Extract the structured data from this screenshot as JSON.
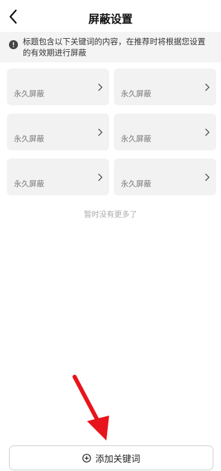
{
  "header": {
    "title": "屏蔽设置",
    "back_icon": "chevron-left-icon"
  },
  "notice": {
    "icon": "info-icon",
    "text": "标题包含以下关键词的内容，在推荐时将根据您设置的有效期进行屏蔽"
  },
  "keywords": [
    {
      "keyword": "",
      "status": "永久屏蔽"
    },
    {
      "keyword": "",
      "status": "永久屏蔽"
    },
    {
      "keyword": "",
      "status": "永久屏蔽"
    },
    {
      "keyword": "",
      "status": "永久屏蔽"
    },
    {
      "keyword": "",
      "status": "永久屏蔽"
    },
    {
      "keyword": "",
      "status": "永久屏蔽"
    }
  ],
  "list_footer": "暂时没有更多了",
  "add_button": {
    "label": "添加关键词",
    "icon": "plus-circle-icon"
  },
  "colors": {
    "annotation_arrow": "#e8141b",
    "card_background": "#f2f2f2",
    "notice_background": "#f4f4f4"
  }
}
